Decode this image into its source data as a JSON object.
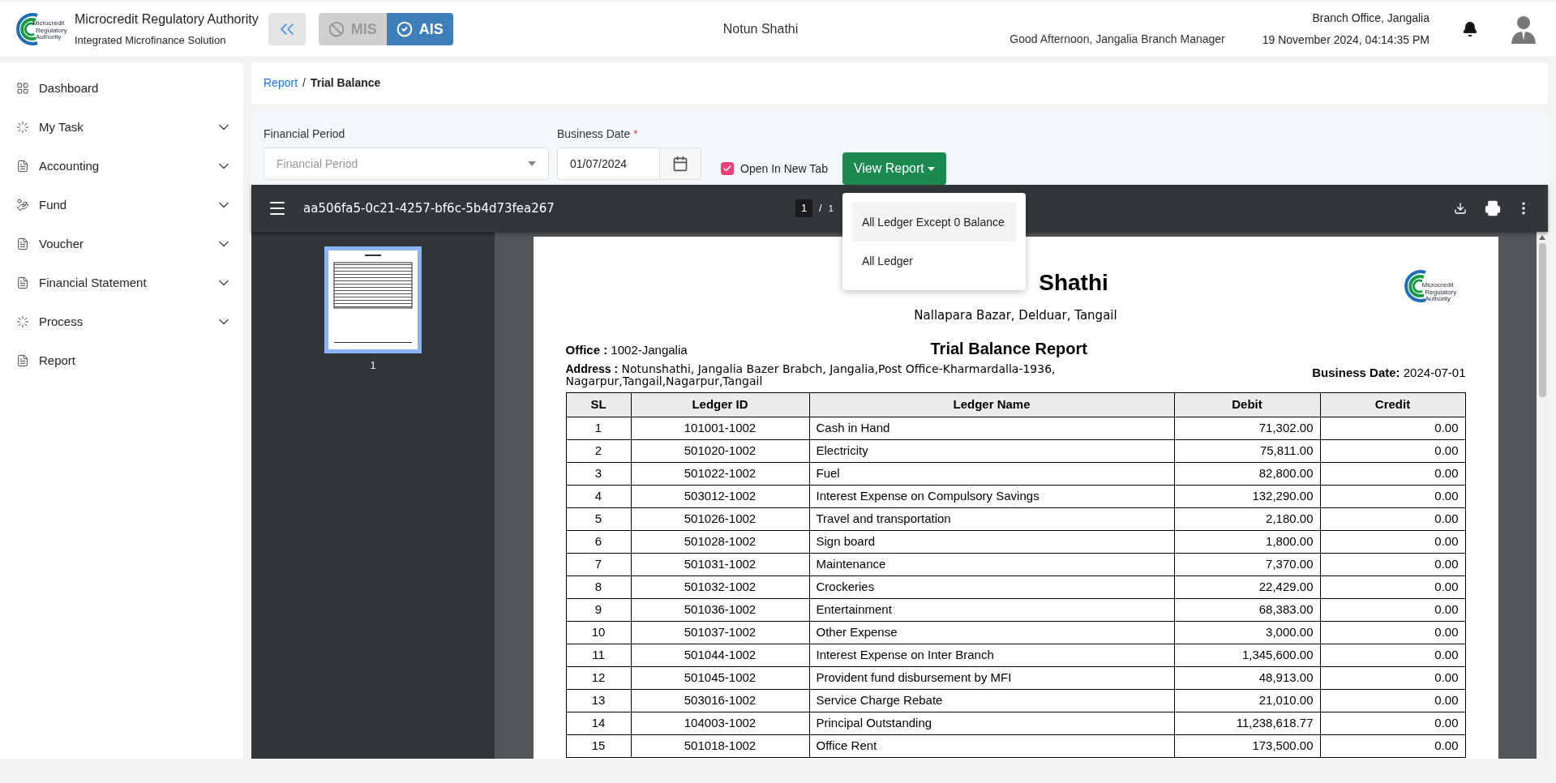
{
  "header": {
    "org_name": "Microcredit Regulatory Authority",
    "org_subtitle": "Integrated Microfinance Solution",
    "logo_text": [
      "Microcredit",
      "Regulatory",
      "Authority"
    ],
    "modules": [
      {
        "label": "MIS",
        "selected": false
      },
      {
        "label": "AIS",
        "selected": true
      }
    ],
    "organization": "Notun Shathi",
    "greeting": "Good Afternoon, Jangalia Branch Manager",
    "branch": "Branch Office, Jangalia",
    "datetime": "19 November 2024, 04:14:35 PM"
  },
  "sidebar": {
    "items": [
      {
        "label": "Dashboard",
        "expandable": false
      },
      {
        "label": "My Task",
        "expandable": true
      },
      {
        "label": "Accounting",
        "expandable": true
      },
      {
        "label": "Fund",
        "expandable": true
      },
      {
        "label": "Voucher",
        "expandable": true
      },
      {
        "label": "Financial Statement",
        "expandable": true
      },
      {
        "label": "Process",
        "expandable": true
      },
      {
        "label": "Report",
        "expandable": false
      }
    ]
  },
  "breadcrumb": {
    "items": [
      {
        "label": "Report",
        "link": true
      },
      {
        "label": "Trial Balance",
        "link": false
      }
    ],
    "separator": "/"
  },
  "filters": {
    "financial_period": {
      "label": "Financial Period",
      "placeholder": "Financial Period"
    },
    "business_date": {
      "label": "Business Date",
      "required": true,
      "required_mark": "*",
      "value": "01/07/2024"
    },
    "open_in_new_tab": {
      "label": "Open In New Tab",
      "checked": true
    },
    "view_report": {
      "label": "View Report"
    },
    "menu": [
      {
        "label": "All Ledger Except 0 Balance",
        "selected": true
      },
      {
        "label": "All Ledger",
        "selected": false
      }
    ]
  },
  "viewer": {
    "filename": "aa506fa5-0c21-4257-bf6c-5b4d73fea267",
    "page": "1",
    "separator": "/",
    "total": "1",
    "thumbnail_label": "1"
  },
  "report": {
    "org_title": "Shathi",
    "org_address": "Nallapara Bazar, Delduar, Tangail",
    "logo_text": [
      "Microcredit",
      "Regulatory",
      "Authority"
    ],
    "office_label": "Office :",
    "office_value": "1002-Jangalia",
    "title": "Trial Balance Report",
    "address_label": "Address :",
    "address_value": "Notunshathi, Jangalia Bazer Brabch, Jangalia,Post Office-Kharmardalla-1936, Nagarpur,Tangail,Nagarpur,Tangail",
    "date_label": "Business Date:",
    "date_value": "2024-07-01",
    "columns": [
      "SL",
      "Ledger ID",
      "Ledger Name",
      "Debit",
      "Credit"
    ],
    "rows": [
      [
        "1",
        "101001-1002",
        "Cash in Hand",
        "71,302.00",
        "0.00"
      ],
      [
        "2",
        "501020-1002",
        "Electricity",
        "75,811.00",
        "0.00"
      ],
      [
        "3",
        "501022-1002",
        "Fuel",
        "82,800.00",
        "0.00"
      ],
      [
        "4",
        "503012-1002",
        "Interest Expense on Compulsory Savings",
        "132,290.00",
        "0.00"
      ],
      [
        "5",
        "501026-1002",
        "Travel and transportation",
        "2,180.00",
        "0.00"
      ],
      [
        "6",
        "501028-1002",
        "Sign board",
        "1,800.00",
        "0.00"
      ],
      [
        "7",
        "501031-1002",
        "Maintenance",
        "7,370.00",
        "0.00"
      ],
      [
        "8",
        "501032-1002",
        "Crockeries",
        "22,429.00",
        "0.00"
      ],
      [
        "9",
        "501036-1002",
        "Entertainment",
        "68,383.00",
        "0.00"
      ],
      [
        "10",
        "501037-1002",
        "Other Expense",
        "3,000.00",
        "0.00"
      ],
      [
        "11",
        "501044-1002",
        "Interest Expense on Inter Branch",
        "1,345,600.00",
        "0.00"
      ],
      [
        "12",
        "501045-1002",
        "Provident fund disbursement by MFI",
        "48,913.00",
        "0.00"
      ],
      [
        "13",
        "503016-1002",
        "Service Charge Rebate",
        "21,010.00",
        "0.00"
      ],
      [
        "14",
        "104003-1002",
        "Principal Outstanding",
        "11,238,618.77",
        "0.00"
      ],
      [
        "15",
        "501018-1002",
        "Office Rent",
        "173,500.00",
        "0.00"
      ]
    ]
  }
}
